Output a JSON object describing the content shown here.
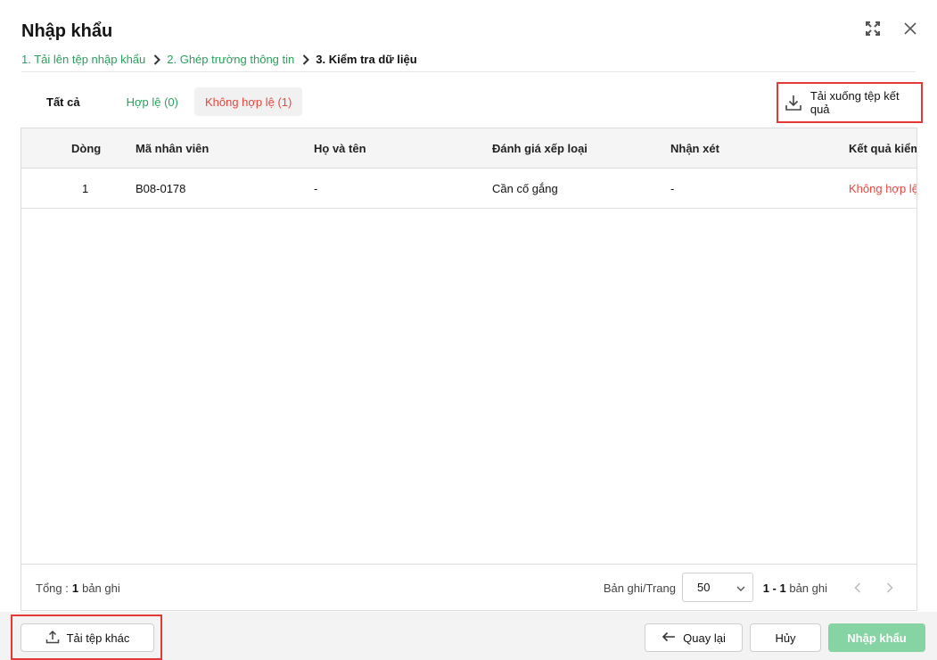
{
  "dialog": {
    "title": "Nhập khẩu"
  },
  "steps": [
    {
      "label": "1. Tải lên tệp nhập khẩu"
    },
    {
      "label": "2. Ghép trường thông tin"
    },
    {
      "label": "3. Kiểm tra dữ liệu"
    }
  ],
  "tabs": {
    "all": "Tất cả",
    "valid": "Hợp lệ (0)",
    "invalid": "Không hợp lệ (1)"
  },
  "actions": {
    "download_result": "Tải xuống tệp kết quả"
  },
  "table": {
    "columns": {
      "row": "Dòng",
      "code": "Mã nhân viên",
      "name": "Họ và tên",
      "grade": "Đánh giá xếp loại",
      "note": "Nhận xét",
      "result": "Kết quả kiểm"
    },
    "rows": [
      {
        "row": "1",
        "code": "B08-0178",
        "name": "-",
        "grade": "Cần cố gắng",
        "note": "-",
        "result": "Không hợp lệ"
      }
    ]
  },
  "footer": {
    "total_label": "Tổng :",
    "total_count": "1",
    "total_unit": "bản ghi",
    "per_page_label": "Bản ghi/Trang",
    "per_page_value": "50",
    "range": "1 - 1",
    "range_unit": "bản ghi"
  },
  "buttons": {
    "upload_other": "Tải tệp khác",
    "back": "Quay lại",
    "cancel": "Hủy",
    "import": "Nhập khẩu"
  },
  "colors": {
    "accent_green": "#2aa05c",
    "error_red": "#e8473f",
    "import_button": "#86d3a3",
    "highlight": "#e53935"
  },
  "icons": [
    "expand-icon",
    "close-icon",
    "chevron-right-icon",
    "download-icon",
    "chevron-down-icon",
    "chevron-left-icon",
    "upload-icon",
    "arrow-left-icon"
  ]
}
